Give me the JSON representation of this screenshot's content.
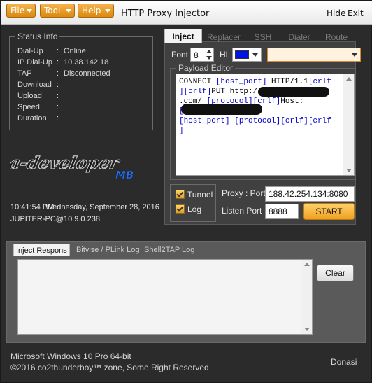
{
  "window": {
    "title": "HTTP Proxy Injector",
    "hide_label": "Hide",
    "exit_label": "Exit"
  },
  "menu": {
    "file": "File",
    "tool": "Tool",
    "help": "Help"
  },
  "status_info": {
    "title": "Status Info",
    "rows": [
      {
        "key": "Dial-Up",
        "value": "Online"
      },
      {
        "key": "IP Dial-Up",
        "value": "10.38.142.18"
      },
      {
        "key": "TAP",
        "value": "Disconnected"
      },
      {
        "key": "Download",
        "value": ""
      },
      {
        "key": "Upload",
        "value": ""
      },
      {
        "key": "Speed",
        "value": ""
      },
      {
        "key": "Duration",
        "value": ""
      }
    ]
  },
  "clock": {
    "time": "10:41:54 PM",
    "date": "Wednesday, September 28, 2016",
    "host": "JUPITER-PC@10.9.0.238"
  },
  "logo": {
    "main": "a-developer",
    "sub": "MB"
  },
  "tabs": [
    "Inject",
    "Replacer",
    "SSH",
    "Dialer",
    "Route"
  ],
  "inject": {
    "font_label": "Font",
    "font_size": "8",
    "hl_label": "HL",
    "hl_color": "#0014e6",
    "payload_title": "Payload Editor",
    "payload_lines": [
      [
        {
          "t": "CONNECT ",
          "c": "k"
        },
        {
          "t": "[host_port]",
          "c": "b"
        },
        {
          "t": " HTTP/1.1",
          "c": "k"
        },
        {
          "t": "[crlf",
          "c": "b"
        }
      ],
      [
        {
          "t": "][crlf]",
          "c": "b"
        },
        {
          "t": "PUT http://",
          "c": "k"
        }
      ],
      [
        {
          "t": ".com/ ",
          "c": "k"
        },
        {
          "t": "[protocol]",
          "c": "b"
        },
        {
          "t": "[crlf]",
          "c": "b"
        },
        {
          "t": "Host:",
          "c": "k"
        }
      ],
      [
        {
          "t": "[crlf]",
          "c": "b"
        },
        {
          "t": "CONNECT",
          "c": "k"
        }
      ],
      [
        {
          "t": "[host_port] [protocol][crlf][crlf",
          "c": "b"
        }
      ],
      [
        {
          "t": "]",
          "c": "b"
        }
      ]
    ],
    "tunnel_label": "Tunnel",
    "log_label": "Log",
    "proxy_port_label": "Proxy : Port",
    "proxy_port_value": "188.42.254.134:8080",
    "listen_port_label": "Listen Port",
    "listen_port_value": "8888",
    "start_label": "START"
  },
  "log_tabs": [
    "Inject Respons",
    "Bitvise / PLink Log",
    "Shell2TAP Log"
  ],
  "clear_label": "Clear",
  "footer": {
    "os": "Microsoft Windows 10 Pro 64-bit",
    "copyright": "©2016 co2thunderboy™ zone, Some Right Reserved",
    "donate": "Donasi"
  }
}
